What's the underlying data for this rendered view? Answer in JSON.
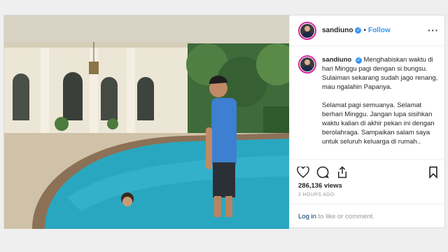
{
  "post": {
    "username": "sandiuno",
    "follow_label": "Follow",
    "more_icon": "more-options-icon",
    "caption": {
      "username": "sandiuno",
      "para1": "Menghabiskan waktu di hari Minggu pagi dengan si bungsu. Sulaiman sekarang sudah jago renang, mau ngalahin Papanya.",
      "para2": "Selamat pagi semuanya. Selamat berhari Minggu. Jangan lupa sisihkan waktu kalian di akhir pekan ini dengan berolahraga. Sampaikan salam saya untuk seluruh keluarga di rumah..",
      "time_ago": "2h"
    },
    "likes": "286,136 views",
    "posted": "2 HOURS AGO",
    "login_link": "Log in",
    "login_rest": " to like or comment."
  },
  "colors": {
    "accent": "#3897f0",
    "link": "#003569",
    "pool": "#2aa7c0"
  }
}
